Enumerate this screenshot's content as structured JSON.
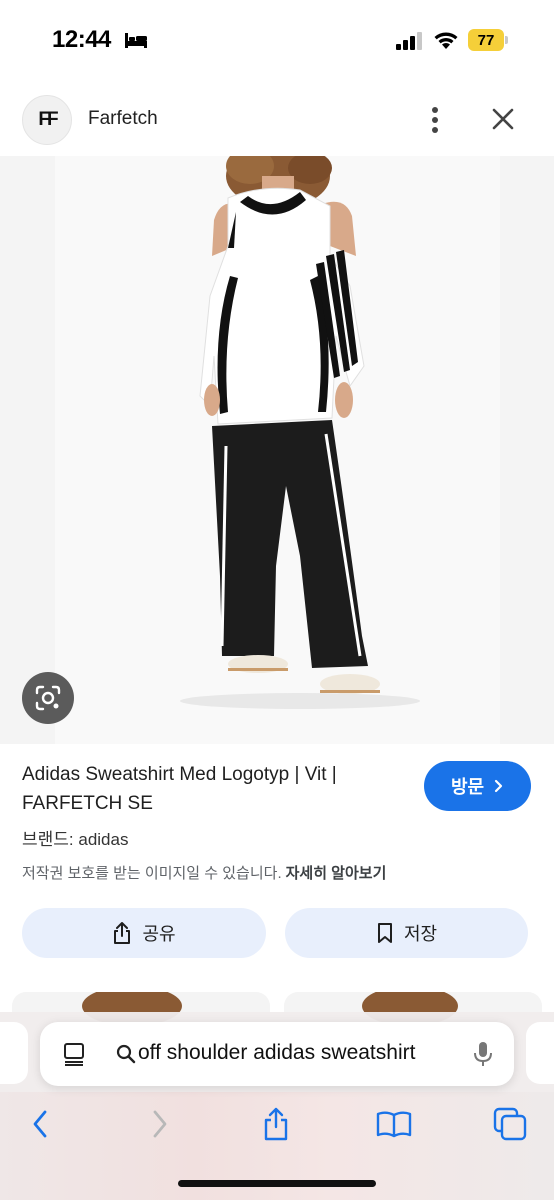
{
  "status_bar": {
    "time": "12:44",
    "battery": "77",
    "battery_color": "#f5cf39"
  },
  "source": {
    "logo_text": "FF",
    "name": "Farfetch"
  },
  "product": {
    "title": "Adidas Sweatshirt Med Logotyp | Vit | FARFETCH SE",
    "visit_label": "방문",
    "brand_line": "브랜드: adidas",
    "copyright_text": "저작권 보호를 받는 이미지일 수 있습니다.",
    "copyright_link": "자세히 알아보기"
  },
  "actions": {
    "share_label": "공유",
    "save_label": "저장"
  },
  "browser": {
    "url_text": "off shoulder adidas sweatshirt"
  },
  "colors": {
    "accent": "#1a73e8",
    "action_bg": "#e8effc"
  },
  "icons": [
    "bed-icon",
    "signal-icon",
    "wifi-icon",
    "more-icon",
    "close-icon",
    "lens-icon",
    "share-icon",
    "bookmark-icon",
    "reader-icon",
    "search-icon",
    "mic-icon",
    "back-icon",
    "forward-icon",
    "bookmarks-icon",
    "tabs-icon"
  ]
}
